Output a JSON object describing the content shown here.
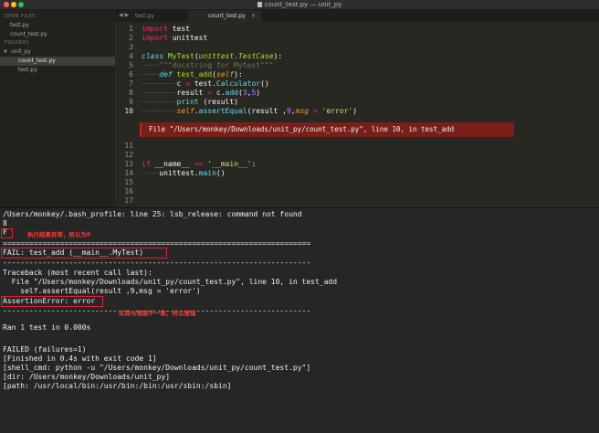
{
  "window": {
    "title": "count_test.py — unit_py"
  },
  "sidebar": {
    "open_files_heading": "OPEN FILES",
    "open_files": [
      {
        "label": "test.py",
        "active": false
      },
      {
        "label": "count_test.py",
        "active": false
      }
    ],
    "folders_heading": "FOLDERS",
    "folder": {
      "label": "unit_py"
    },
    "folder_files": [
      {
        "label": "count_test.py",
        "active": true
      },
      {
        "label": "test.py",
        "active": false
      }
    ]
  },
  "tabs": [
    {
      "label": "test.py",
      "active": false
    },
    {
      "label": "count_test.py",
      "active": true
    }
  ],
  "editor": {
    "line_numbers": [
      "1",
      "2",
      "3",
      "4",
      "5",
      "6",
      "7",
      "8",
      "9",
      "10",
      "11",
      "12",
      "13",
      "14",
      "15",
      "16",
      "17"
    ],
    "lines": {
      "l1_kw": "import",
      "l1_rest": " test",
      "l2_kw": "import",
      "l2_rest": " unittest",
      "l4_kw": "class",
      "l4_name": " MyTest",
      "l4_paren_open": "(",
      "l4_base": "unittest.TestCase",
      "l4_paren_close": "):",
      "l5_ws": "────",
      "l5_doc": "\"\"\"docstring for Mytest\"\"\"",
      "l6_ws": "────",
      "l6_kw": "def",
      "l6_name": " test_add",
      "l6_paren_open": "(",
      "l6_self": "self",
      "l6_paren_close": "):",
      "l7_ws": "────────",
      "l7_a": "c ",
      "l7_op": "=",
      "l7_b": " test.",
      "l7_fn": "Calculator",
      "l7_c": "()",
      "l8_ws": "────────",
      "l8_a": "result ",
      "l8_op": "=",
      "l8_b": " c.",
      "l8_fn": "add",
      "l8_c": "(",
      "l8_n1": "3",
      "l8_d": ",",
      "l8_n2": "5",
      "l8_e": ")",
      "l9_ws": "────────",
      "l9_builtin": "print",
      "l9_rest": " (result)",
      "l10_ws": "────────",
      "l10_self": "self",
      "l10_a": ".",
      "l10_fn": "assertEqual",
      "l10_b": "(result ,",
      "l10_n": "9",
      "l10_c": ",",
      "l10_kwarg": "msg",
      "l10_op": " = ",
      "l10_str": "'error'",
      "l10_d": ")",
      "l13_kw": "if",
      "l13_a": " __name__ ",
      "l13_op": "==",
      "l13_b": " ",
      "l13_str": "'__main__'",
      "l13_c": ":",
      "l14_ws": "────",
      "l14_rest": "unittest.",
      "l14_fn": "main",
      "l14_c": "()"
    },
    "error_annotation": "File \"/Users/monkey/Downloads/unit_py/count_test.py\", line 10, in test_add"
  },
  "output": {
    "lines": [
      "/Users/monkey/.bash_profile: line 25: lsb_release: command not found",
      "8",
      "F",
      "======================================================================",
      "FAIL: test_add (__main__.MyTest)",
      "----------------------------------------------------------------------",
      "Traceback (most recent call last):",
      "  File \"/Users/monkey/Downloads/unit_py/count_test.py\", line 10, in test_add",
      "    self.assertEqual(result ,9,msg = 'error')",
      "AssertionError: error",
      "----------------------------------------------------------------------",
      "Ran 1 test in 0.000s",
      "",
      "FAILED (failures=1)",
      "[Finished in 0.4s with exit code 1]",
      "[shell_cmd: python -u \"/Users/monkey/Downloads/unit_py/count_test.py\"]",
      "[dir: /Users/monkey/Downloads/unit_py]",
      "[path: /usr/local/bin:/usr/bin:/bin:/usr/sbin:/sbin]"
    ],
    "annotation_1": "执行结果异常，所以为F",
    "annotation_2": "实际与预期不一致，所以报错"
  },
  "colors": {
    "annotation_red": "#e0222e",
    "error_bar": "#7a1e1a"
  }
}
